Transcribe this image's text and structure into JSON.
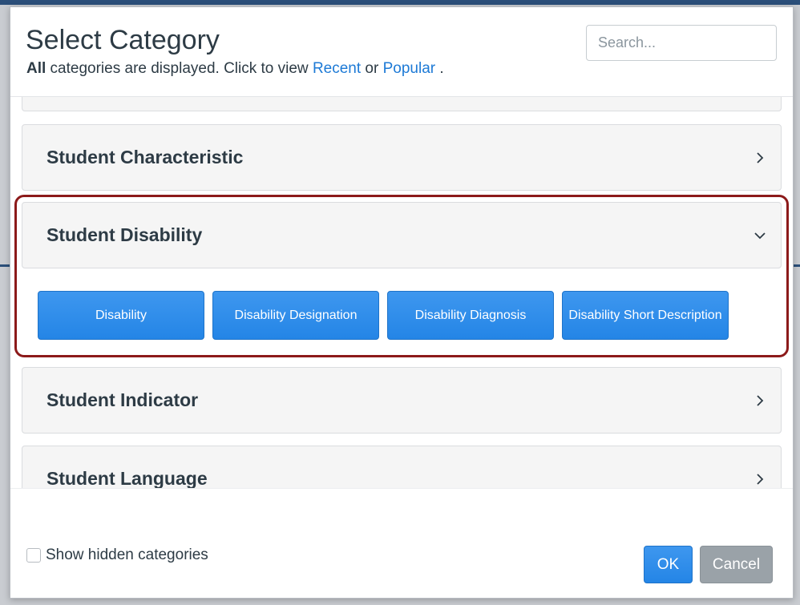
{
  "dialog": {
    "title": "Select Category",
    "subtitle_bold": "All",
    "subtitle_text": " categories are displayed. Click to view ",
    "link_recent": "Recent",
    "subtitle_or": " or ",
    "link_popular": "Popular",
    "subtitle_end": " .",
    "search_placeholder": "Search..."
  },
  "categories": [
    {
      "label": "Student Characteristic",
      "state": "collapsed",
      "chevron": "chevron-right-icon"
    },
    {
      "label": "Student Disability",
      "state": "expanded",
      "chevron": "chevron-down-icon",
      "items": [
        "Disability",
        "Disability Designation",
        "Disability Diagnosis",
        "Disability Short Description"
      ]
    },
    {
      "label": "Student Indicator",
      "state": "collapsed",
      "chevron": "chevron-right-icon"
    },
    {
      "label": "Student Language",
      "state": "collapsed",
      "chevron": "chevron-right-icon"
    }
  ],
  "footer": {
    "show_hidden_label": "Show hidden categories",
    "show_hidden_checked": false,
    "ok_label": "OK",
    "cancel_label": "Cancel"
  },
  "colors": {
    "accent": "#2485e6",
    "highlight_frame": "#8c1a1a",
    "text": "#2d3b45",
    "link": "#1d7ad6",
    "cancel": "#9aa2a8"
  }
}
